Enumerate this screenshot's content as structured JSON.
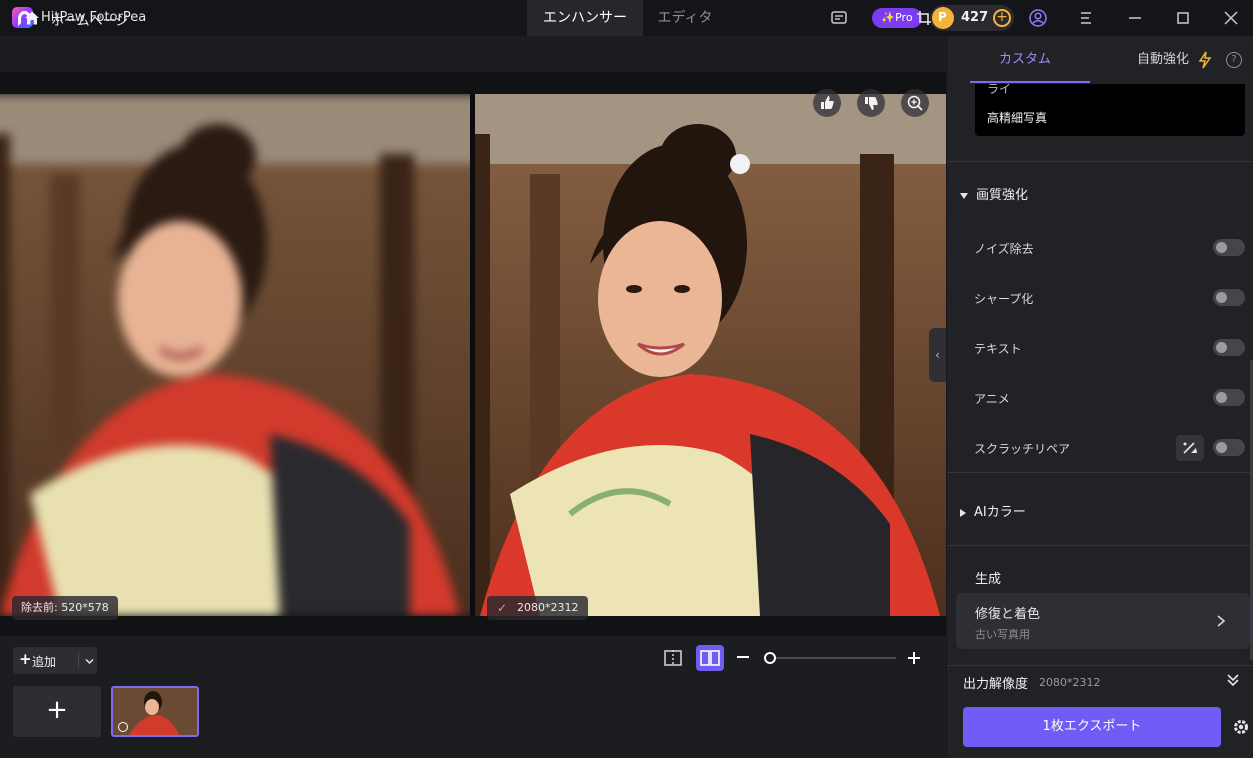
{
  "app": {
    "title": "HitPaw FotorPea",
    "modes": [
      "エンハンサー",
      "エディタ"
    ],
    "pro_badge": "✨Pro",
    "credits": "427"
  },
  "nav": {
    "home_label": "ホームページ"
  },
  "images": {
    "before_label": "除去前: 520*578",
    "after_label": "2080*2312"
  },
  "toolbar": {
    "add_label": "追加"
  },
  "panel": {
    "tabs": [
      "カスタム",
      "自動強化"
    ],
    "preset_cut_label": "ライ",
    "preset_item": "高精細写真",
    "quality_section": "画質強化",
    "options": [
      {
        "label": "ノイズ除去",
        "on": false
      },
      {
        "label": "シャープ化",
        "on": false
      },
      {
        "label": "テキスト",
        "on": false
      },
      {
        "label": "アニメ",
        "on": false
      },
      {
        "label": "スクラッチリペア",
        "on": false
      }
    ],
    "ai_color_section": "AIカラー",
    "generation_title": "生成",
    "gen_card": {
      "title": "修復と着色",
      "subtitle": "古い写真用"
    },
    "output_resolution_label": "出力解像度",
    "output_resolution_value": "2080*2312",
    "export_label": "1枚エクスポート"
  },
  "colors": {
    "accent": "#6f5cf4",
    "panel_bg": "#212226",
    "app_bg": "#1c1d21"
  }
}
